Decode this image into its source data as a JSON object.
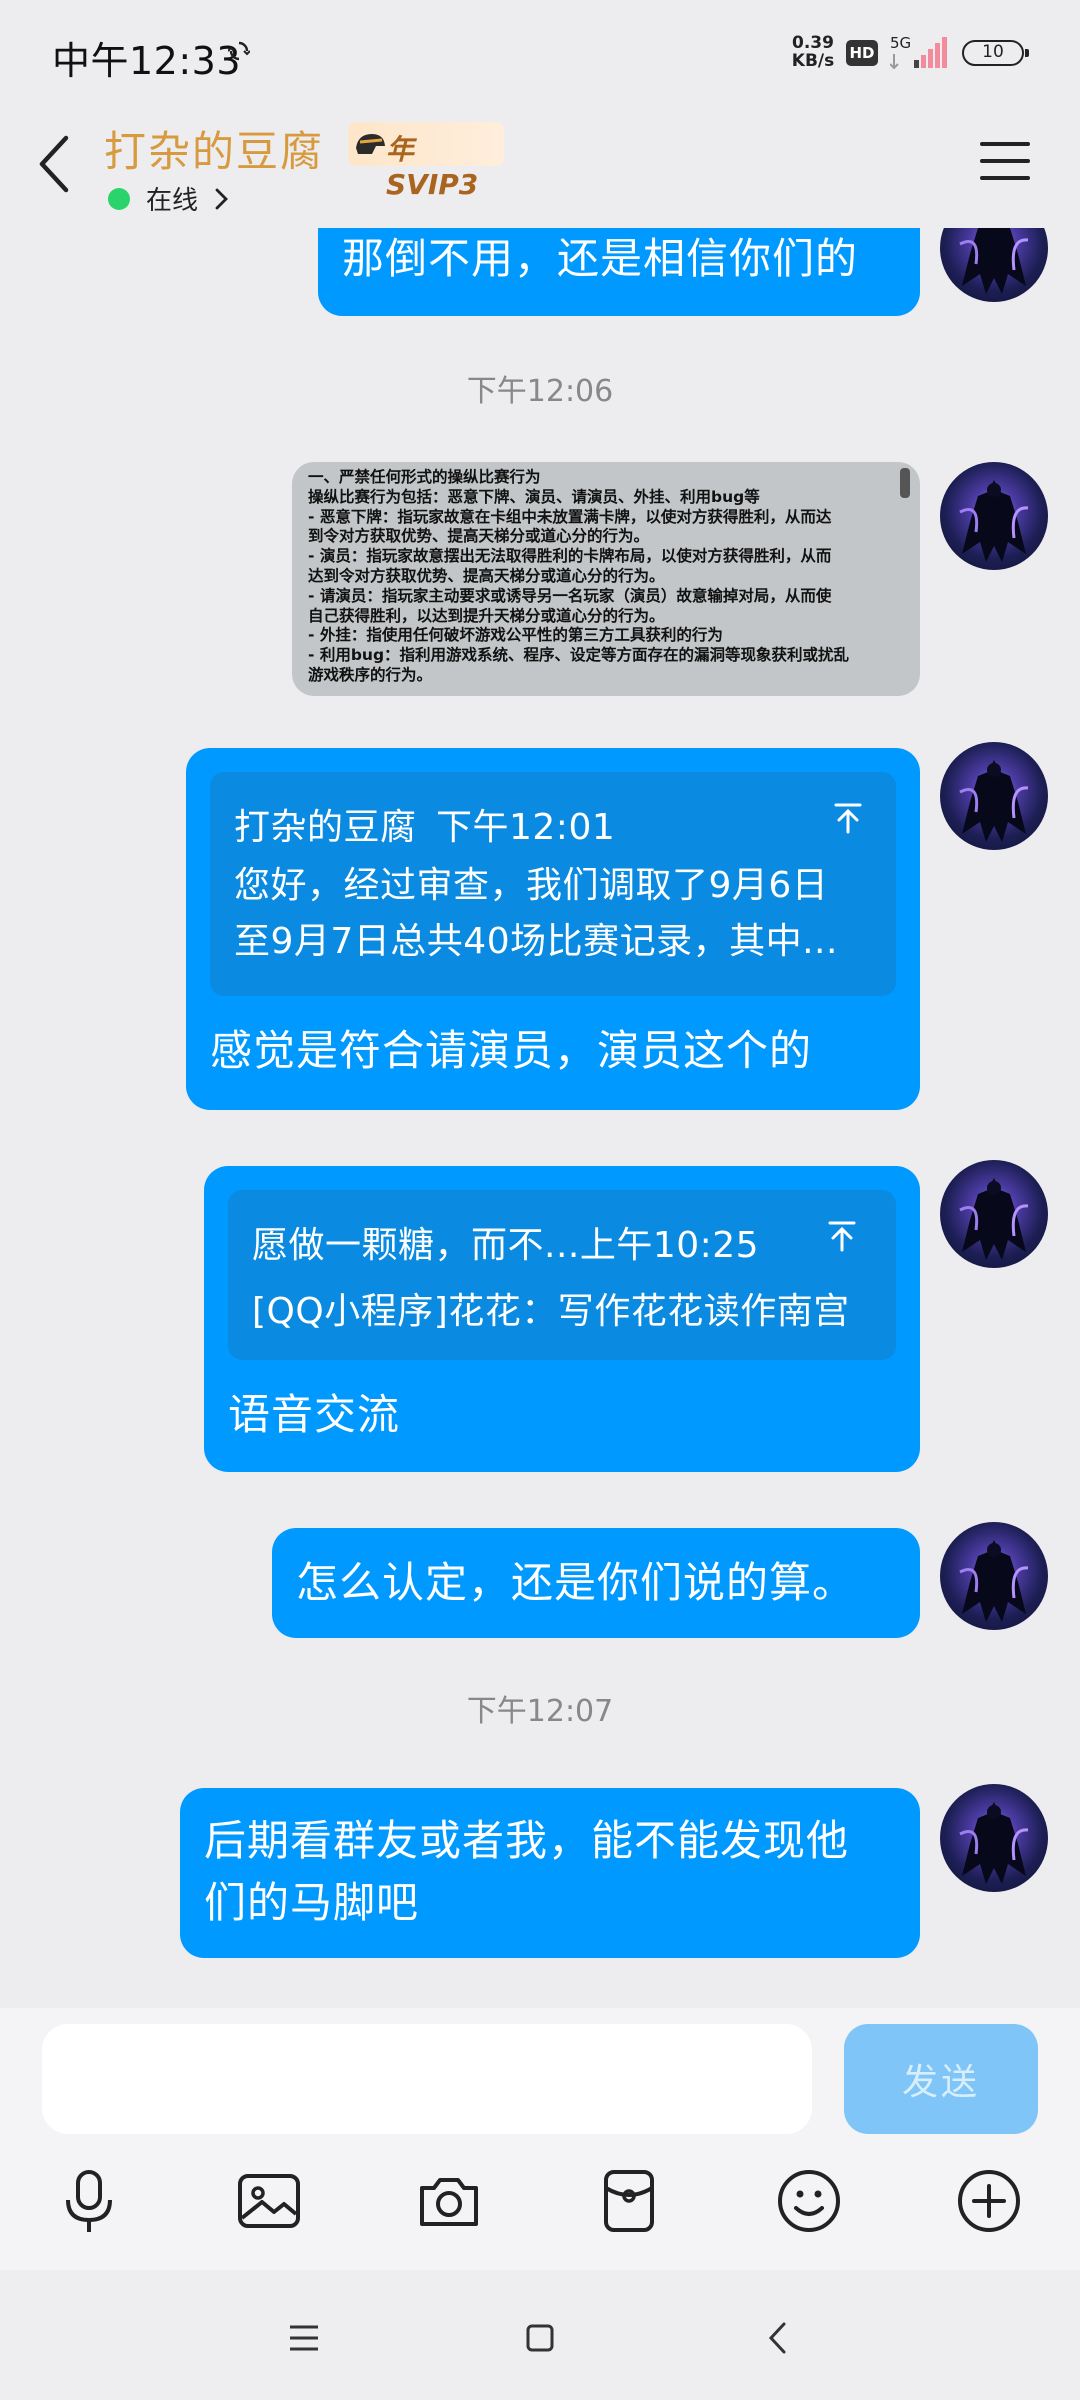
{
  "status_bar": {
    "time": "中午12:33",
    "net_speed_value": "0.39",
    "net_speed_unit": "KB/s",
    "hd_label": "HD",
    "network_label": "5G",
    "battery_level": "10"
  },
  "header": {
    "contact_name": "打杂的豆腐",
    "vip_badge": "年SVIP3",
    "status_text": "在线"
  },
  "messages": {
    "msg1": {
      "text": "那倒不用，还是相信你们的"
    },
    "time1": "下午12:06",
    "image_msg": {
      "lines": [
        "一、严禁任何形式的操纵比赛行为",
        "操纵比赛行为包括：恶意下牌、演员、请演员、外挂、利用bug等",
        "- 恶意下牌：指玩家故意在卡组中未放置满卡牌，以使对方获得胜利，从而达",
        "到令对方获取优势、提高天梯分或道心分的行为。",
        "- 演员：指玩家故意摆出无法取得胜利的卡牌布局，以使对方获得胜利，从而",
        "达到令对方获取优势、提高天梯分或道心分的行为。",
        "- 请演员：指玩家主动要求或诱导另一名玩家（演员）故意输掉对局，从而使",
        "自己获得胜利，以达到提升天梯分或道心分的行为。",
        "- 外挂：指使用任何破坏游戏公平性的第三方工具获利的行为",
        "- 利用bug：指利用游戏系统、程序、设定等方面存在的漏洞等现象获利或扰乱",
        "游戏秩序的行为。"
      ]
    },
    "msg3": {
      "quote_sender": "打杂的豆腐",
      "quote_time": "下午12:01",
      "quote_line1": "您好，经过审查，我们调取了9月6日",
      "quote_line2": "至9月7日总共40场比赛记录，其中...",
      "text": "感觉是符合请演员，演员这个的"
    },
    "msg4": {
      "quote_header": "愿做一颗糖，而不...上午10:25",
      "quote_line1": "[QQ小程序]花花：写作花花读作南宫",
      "text": "语音交流"
    },
    "msg5": {
      "text": "怎么认定，还是你们说的算。"
    },
    "time2": "下午12:07",
    "msg6": {
      "line1": "后期看群友或者我，能不能发现他",
      "line2": "们的马脚吧"
    }
  },
  "input": {
    "placeholder": "",
    "value": "",
    "send_label": "发送"
  },
  "colors": {
    "bubble": "#0099ff",
    "quote_box": "#0a8ae0",
    "name": "#d89a3e",
    "online": "#2bd36c",
    "send_disabled": "#80c5f7"
  },
  "icons": {
    "toolbar": [
      "microphone-icon",
      "image-icon",
      "camera-icon",
      "red-packet-icon",
      "emoji-icon",
      "plus-icon"
    ],
    "nav": [
      "menu-icon",
      "home-icon",
      "back-icon"
    ]
  }
}
